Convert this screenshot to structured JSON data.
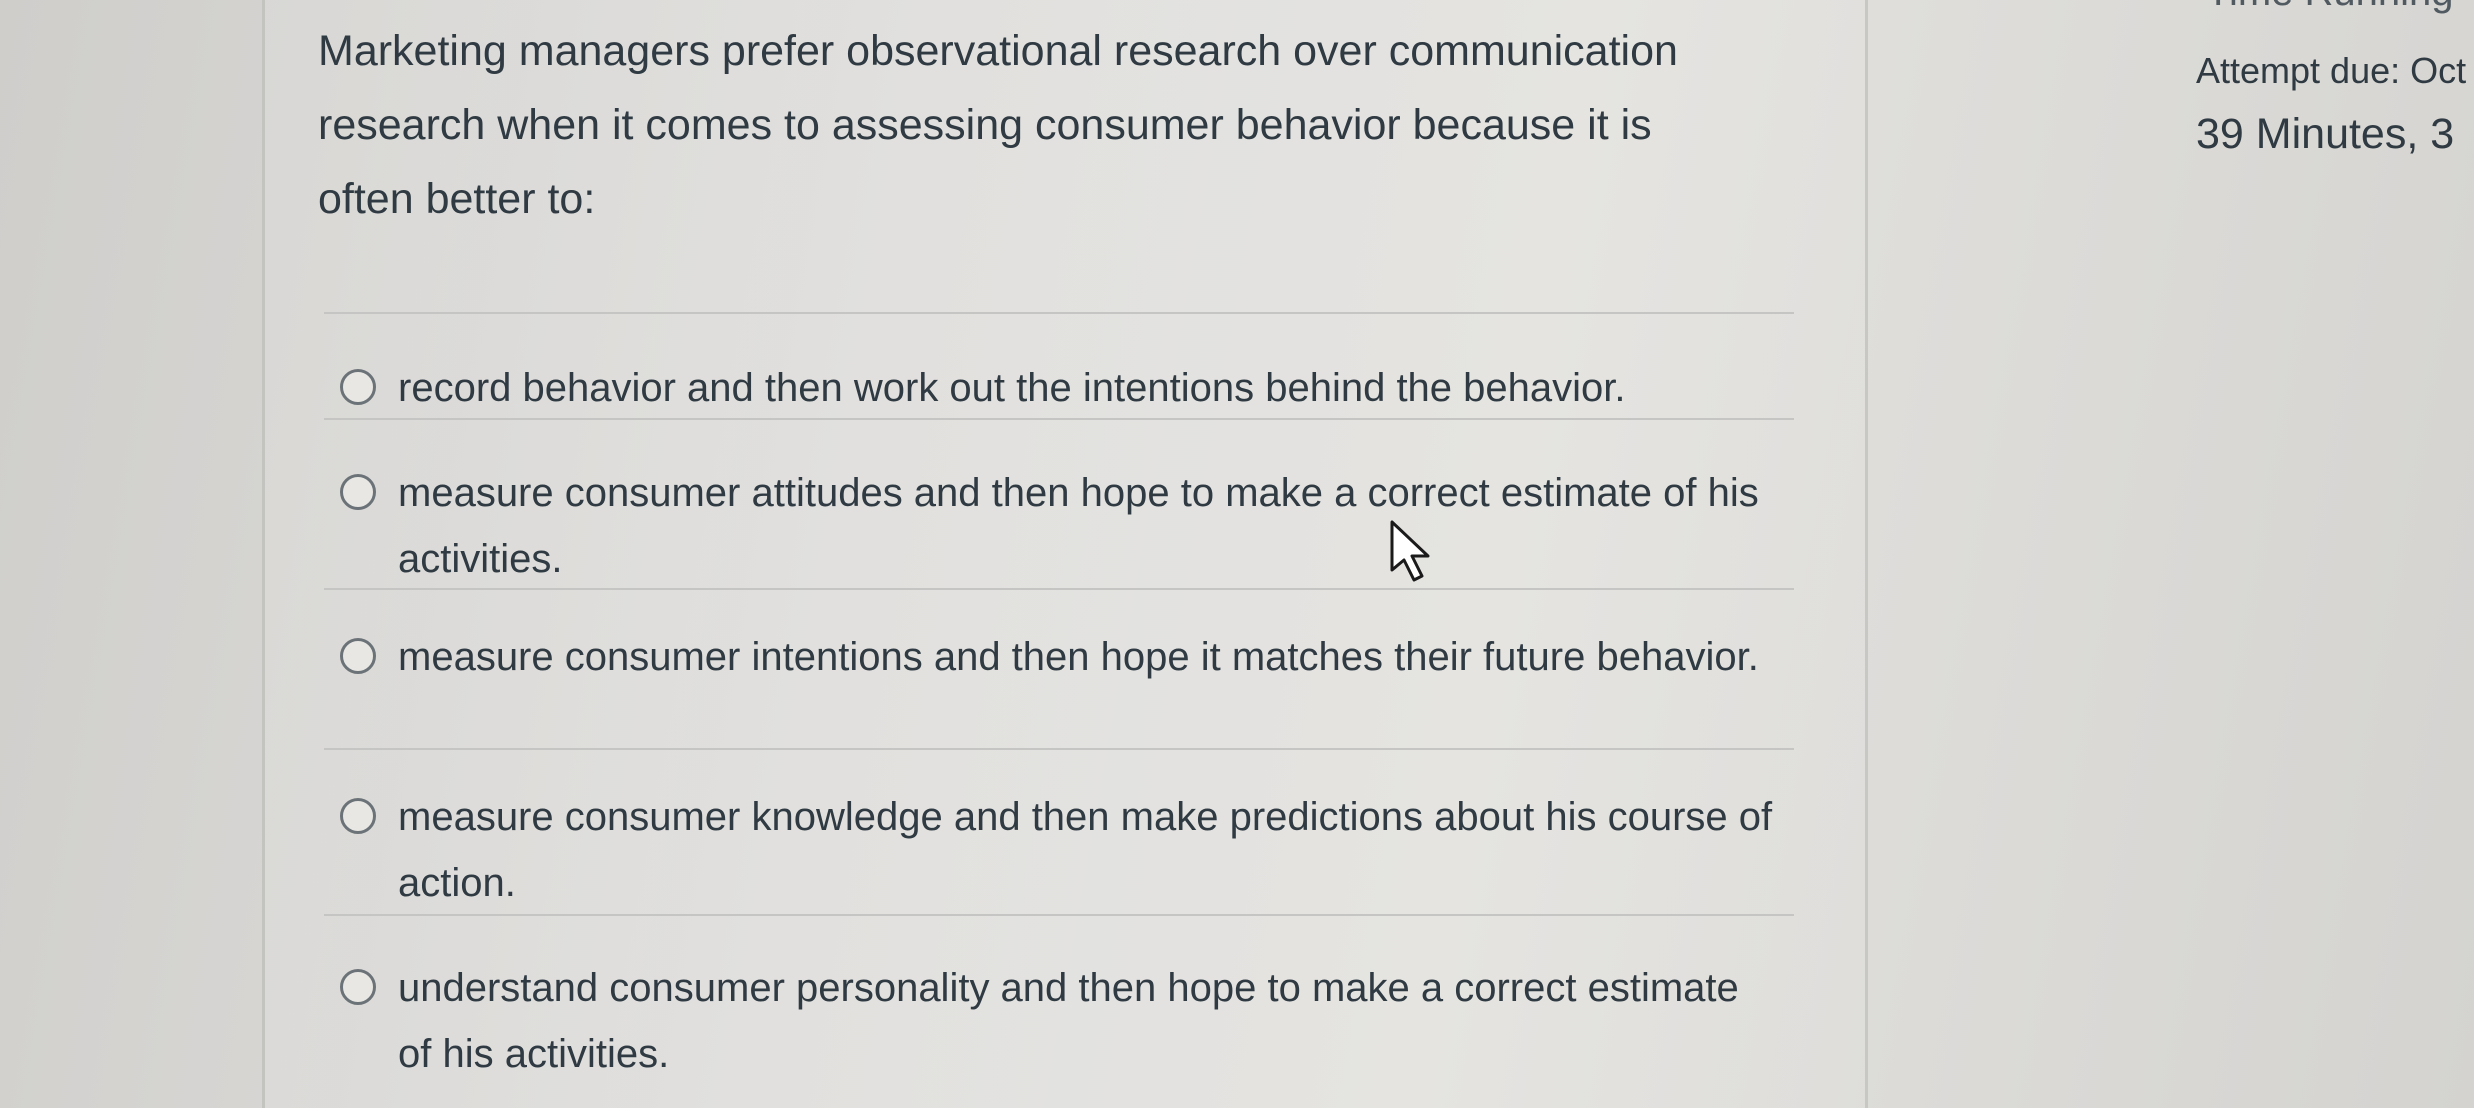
{
  "question": {
    "text": "Marketing managers prefer observational research over communication research when it comes to assessing consumer behavior because it is often better to:"
  },
  "answers": [
    {
      "label": "record behavior and then work out the intentions behind the behavior."
    },
    {
      "label": "measure consumer attitudes and then hope to make a correct estimate of his activities."
    },
    {
      "label": "measure consumer intentions and then hope it matches their future behavior."
    },
    {
      "label": "measure consumer knowledge and then make predictions about his course of action."
    },
    {
      "label": "understand consumer personality and then hope to make a correct estimate of his activities."
    }
  ],
  "sidebar": {
    "time_running": "Time Running",
    "attempt_due": "Attempt due: Oct",
    "time_left": "39 Minutes, 3"
  },
  "cursor_icon": "pointer-cursor-icon"
}
